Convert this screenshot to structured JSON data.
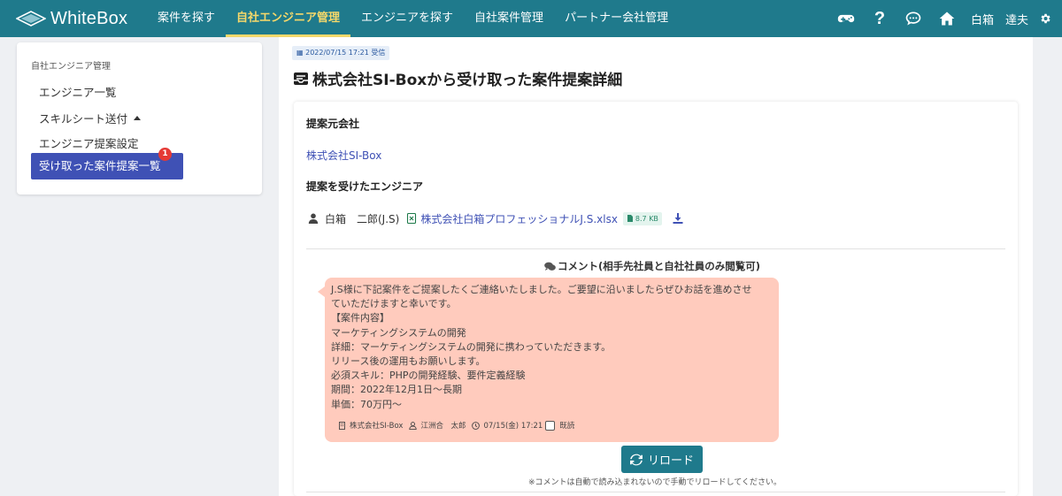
{
  "app": {
    "brand": "WhiteBox"
  },
  "nav": {
    "items": [
      {
        "label": "案件を探す"
      },
      {
        "label": "自社エンジニア管理"
      },
      {
        "label": "エンジニアを探す"
      },
      {
        "label": "自社案件管理"
      },
      {
        "label": "パートナー会社管理"
      }
    ],
    "active_index": 1
  },
  "topbar": {
    "icons": [
      "gamepad-icon",
      "question-icon",
      "chat-icon",
      "home-icon",
      "gear-icon"
    ],
    "help_glyph": "?",
    "user_name": "白箱　達夫"
  },
  "sidebar": {
    "heading": "自社エンジニア管理",
    "items": [
      {
        "label": "エンジニア一覧"
      },
      {
        "label": "スキルシート送付"
      },
      {
        "label": "エンジニア提案設定"
      },
      {
        "label": "受け取った案件提案一覧",
        "badge": "1"
      }
    ]
  },
  "main": {
    "received_date": "2022/07/15 17:21 受信",
    "title": "株式会社SI-Boxから受け取った案件提案詳細",
    "source_company_label": "提案元会社",
    "source_company": "株式会社SI-Box",
    "engineer_label": "提案を受けたエンジニア",
    "engineer_name": "白箱　二郎(J.S)",
    "file_name": "株式会社白箱プロフェッショナルJ.S.xlsx",
    "file_size": "8.7 KB",
    "comment_heading": "コメント(相手先社員と自社社員のみ閲覧可)",
    "comment_lines": [
      "J.S様に下記案件をご提案したくご連絡いたしました。ご要望に沿いましたらぜひお話を進めさせ",
      "ていただけますと幸いです。",
      "【案件内容】",
      "マーケティングシステムの開発",
      "詳細：マーケティングシステムの開発に携わっていただきます。",
      "リリース後の運用もお願いします。",
      "必須スキル：PHPの開発経験、要件定義経験",
      "期間：2022年12月1日～長期",
      "単価：70万円～"
    ],
    "comment_meta": {
      "company": "株式会社SI-Box",
      "author": "江洲合　太郎",
      "time": "07/15(金) 17:21",
      "read_label": "既読"
    },
    "reload_label": "リロード",
    "reload_note": "※コメントは自動で読み込まれないので手動でリロードしてください。"
  },
  "colors": {
    "topbar": "#1f7a8c",
    "nav_active": "#f5d86a",
    "sidebar_active": "#3f51b5",
    "badge": "#e53935",
    "bubble": "#ffcbbd",
    "link": "#3f51b5"
  }
}
